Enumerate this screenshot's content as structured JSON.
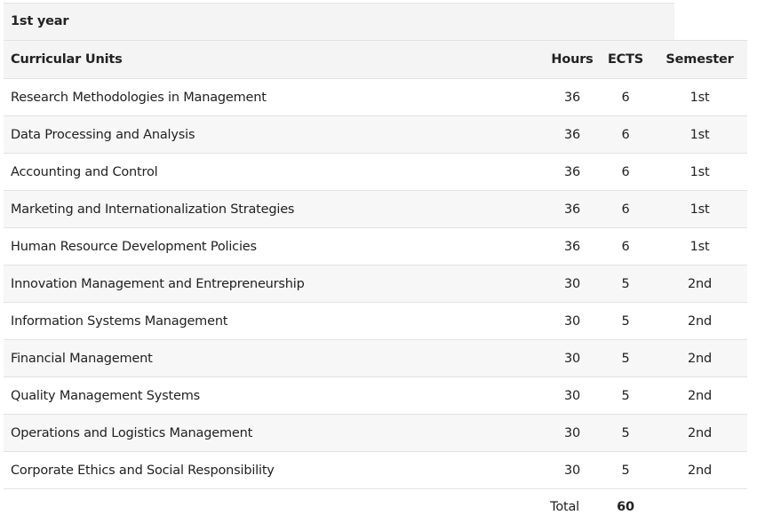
{
  "year": {
    "title": "1st year"
  },
  "table": {
    "headers": {
      "unit": "Curricular Units",
      "hours": "Hours",
      "ects": "ECTS",
      "semester": "Semester"
    },
    "rows": [
      {
        "unit": "Research Methodologies in Management",
        "hours": "36",
        "ects": "6",
        "semester": "1st"
      },
      {
        "unit": "Data Processing and Analysis",
        "hours": "36",
        "ects": "6",
        "semester": "1st"
      },
      {
        "unit": "Accounting and Control",
        "hours": "36",
        "ects": "6",
        "semester": "1st"
      },
      {
        "unit": "Marketing and Internationalization Strategies",
        "hours": "36",
        "ects": "6",
        "semester": "1st"
      },
      {
        "unit": "Human Resource Development Policies",
        "hours": "36",
        "ects": "6",
        "semester": "1st"
      },
      {
        "unit": "Innovation Management and Entrepreneurship",
        "hours": "30",
        "ects": "5",
        "semester": "2nd"
      },
      {
        "unit": "Information Systems Management",
        "hours": "30",
        "ects": "5",
        "semester": "2nd"
      },
      {
        "unit": "Financial Management",
        "hours": "30",
        "ects": "5",
        "semester": "2nd"
      },
      {
        "unit": "Quality Management Systems",
        "hours": "30",
        "ects": "5",
        "semester": "2nd"
      },
      {
        "unit": "Operations and Logistics Management",
        "hours": "30",
        "ects": "5",
        "semester": "2nd"
      },
      {
        "unit": "Corporate Ethics and Social Responsibility",
        "hours": "30",
        "ects": "5",
        "semester": "2nd"
      }
    ],
    "footer": {
      "total_label": "Total",
      "total_ects": "60"
    }
  }
}
